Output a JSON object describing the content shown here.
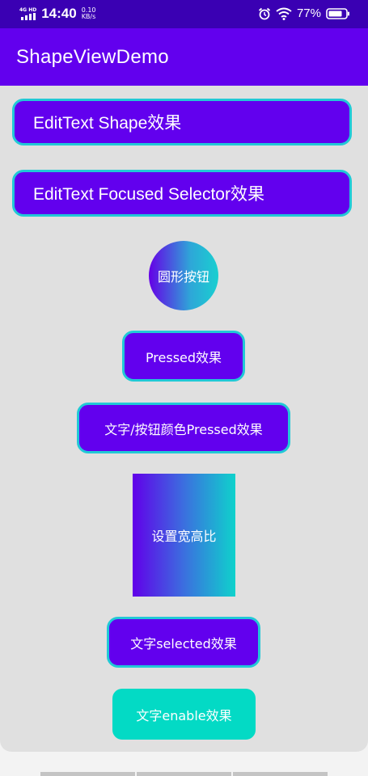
{
  "status_bar": {
    "network": "4G HD",
    "time": "14:40",
    "speed_value": "0.10",
    "speed_unit": "KB/s",
    "battery": "77%",
    "icons": [
      "signal-icon",
      "alarm-icon",
      "wifi-icon",
      "battery-icon"
    ]
  },
  "app_bar": {
    "title": "ShapeViewDemo"
  },
  "content": {
    "edit_shape": "EditText Shape效果",
    "edit_focused": "EditText Focused Selector效果",
    "circle_button": "圆形按钮",
    "pressed_button": "Pressed效果",
    "text_color_pressed_button": "文字/按钮颜色Pressed效果",
    "ratio_view": "设置宽高比",
    "selected_button": "文字selected效果",
    "enable_button": "文字enable效果"
  },
  "colors": {
    "status_bar": "#3a00b3",
    "primary": "#6200ee",
    "accent": "#03dac5",
    "outline": "#21c9d6",
    "panel": "#e0e0e0"
  }
}
